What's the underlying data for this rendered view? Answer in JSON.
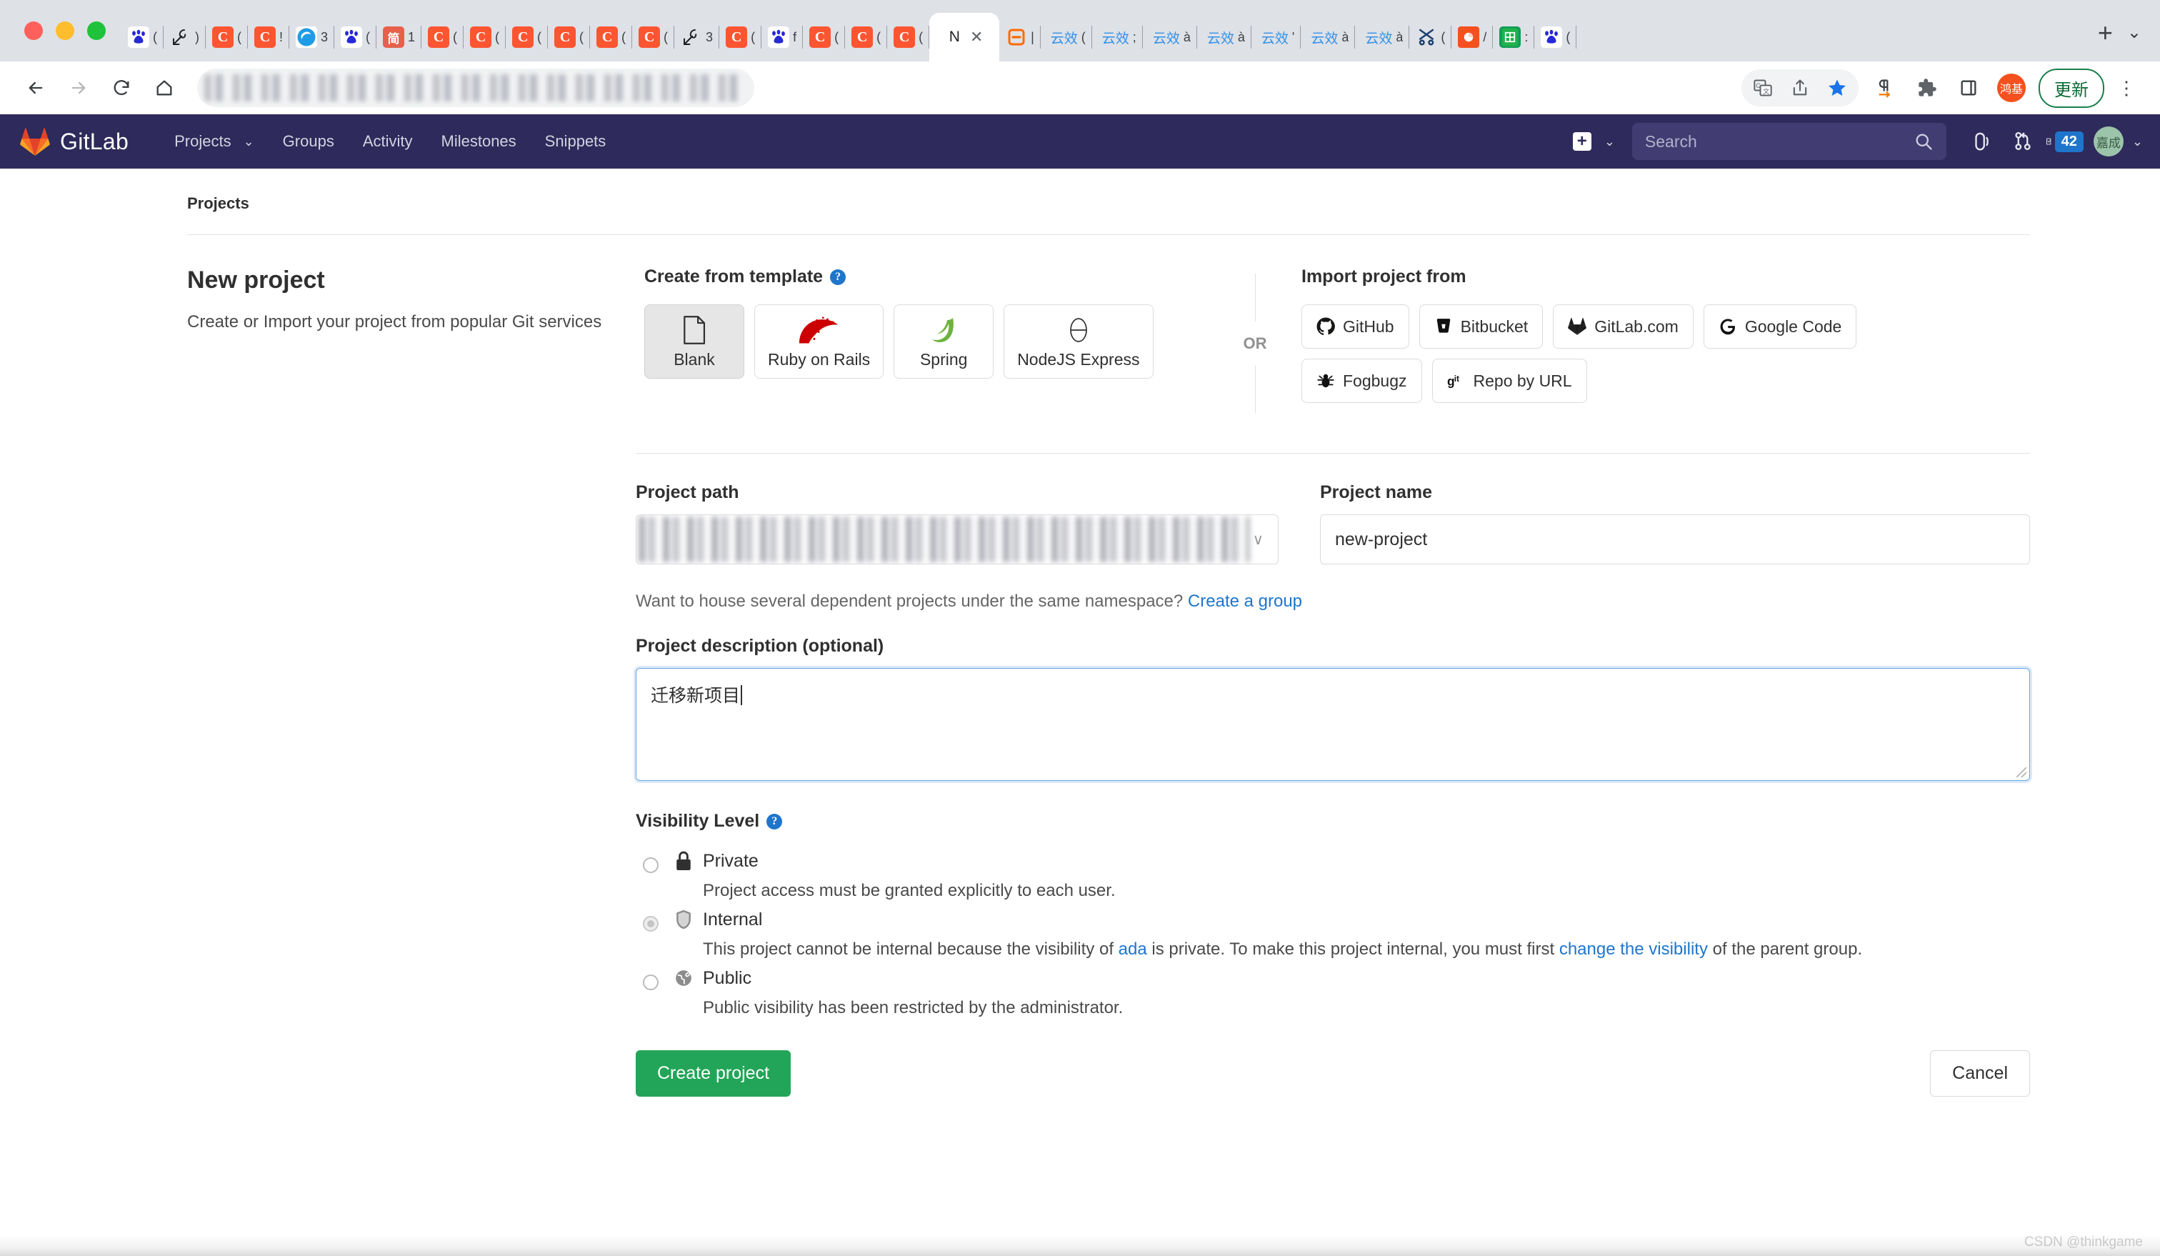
{
  "browser": {
    "window_controls": [
      "close",
      "minimize",
      "maximize"
    ],
    "tabs": [
      {
        "favicon": "baidu-icon",
        "title": "("
      },
      {
        "favicon": "onshape-icon",
        "title": ")"
      },
      {
        "favicon": "csdn-icon",
        "title": "("
      },
      {
        "favicon": "csdn-icon",
        "title": "!"
      },
      {
        "favicon": "edge-icon",
        "title": "3"
      },
      {
        "favicon": "baidu-icon",
        "title": "("
      },
      {
        "favicon": "jianshu-icon",
        "title": "1"
      },
      {
        "favicon": "csdn-icon",
        "title": "("
      },
      {
        "favicon": "csdn-icon",
        "title": "("
      },
      {
        "favicon": "csdn-icon",
        "title": "("
      },
      {
        "favicon": "csdn-icon",
        "title": "("
      },
      {
        "favicon": "csdn-icon",
        "title": "("
      },
      {
        "favicon": "csdn-icon",
        "title": "("
      },
      {
        "favicon": "onshape-icon",
        "title": "3"
      },
      {
        "favicon": "csdn-icon",
        "title": "("
      },
      {
        "favicon": "baidu-icon",
        "title": "f"
      },
      {
        "favicon": "csdn-icon",
        "title": "("
      },
      {
        "favicon": "csdn-icon",
        "title": "("
      },
      {
        "favicon": "csdn-icon",
        "title": "("
      }
    ],
    "active_tab": {
      "title": "N",
      "close_label": "✕"
    },
    "tabs_after": [
      {
        "favicon": "teambition-icon",
        "title": "|"
      },
      {
        "favicon": "",
        "title": "云效",
        "sub": "("
      },
      {
        "favicon": "",
        "title": "云效",
        "sub": ";"
      },
      {
        "favicon": "",
        "title": "云效",
        "sub": "à"
      },
      {
        "favicon": "",
        "title": "云效",
        "sub": "à"
      },
      {
        "favicon": "",
        "title": "云效",
        "sub": "'"
      },
      {
        "favicon": "",
        "title": "云效",
        "sub": "à"
      },
      {
        "favicon": "",
        "title": "云效",
        "sub": "à"
      },
      {
        "favicon": "xmind-icon",
        "title": "("
      },
      {
        "favicon": "wps-ppt-icon",
        "title": "/"
      },
      {
        "favicon": "wps-sheet-icon",
        "title": ":"
      },
      {
        "favicon": "baidu-icon",
        "title": "("
      }
    ],
    "new_tab_label": "+",
    "tabstrip_expander": "⌄",
    "nav": {
      "back": "back-arrow",
      "forward": "forward-arrow",
      "reload": "reload",
      "home": "home"
    },
    "omnibox_value": "",
    "toolbar_right": {
      "translate": "translate-icon",
      "share": "share-icon",
      "bookmark": "bookmark-star-icon",
      "pilcrow": "pilcrow-icon",
      "extensions": "puzzle-icon",
      "sidebar": "sidebar-icon",
      "profile_initials": "鸿基",
      "update_label": "更新",
      "menu": "kebab-menu-icon"
    }
  },
  "gitlab_nav": {
    "brand": "GitLab",
    "items": [
      {
        "label": "Projects",
        "has_caret": true
      },
      {
        "label": "Groups",
        "has_caret": false
      },
      {
        "label": "Activity",
        "has_caret": false
      },
      {
        "label": "Milestones",
        "has_caret": false
      },
      {
        "label": "Snippets",
        "has_caret": false
      }
    ],
    "search_placeholder": "Search",
    "search_value": "",
    "todos_count": "42",
    "avatar_initials": "嘉成",
    "accent_bg": "#2e2a5b",
    "search_bg": "#413d72",
    "badge_color": "#1f75cb"
  },
  "page": {
    "breadcrumb": "Projects",
    "title": "New project",
    "subtitle": "Create or Import your project from popular Git services",
    "watermark": "CSDN @thinkgame"
  },
  "templates": {
    "section_title": "Create from template",
    "help_glyph": "?",
    "cards": [
      {
        "label": "Blank",
        "icon": "blank-file-icon",
        "selected": true
      },
      {
        "label": "Ruby on Rails",
        "icon": "rails-icon",
        "selected": false
      },
      {
        "label": "Spring",
        "icon": "spring-leaf-icon",
        "selected": false
      },
      {
        "label": "NodeJS Express",
        "icon": "express-icon",
        "selected": false
      }
    ]
  },
  "divider": {
    "or_label": "OR"
  },
  "import": {
    "section_title": "Import project from",
    "row1": [
      {
        "label": "GitHub",
        "icon": "github-icon"
      },
      {
        "label": "Bitbucket",
        "icon": "bitbucket-icon"
      },
      {
        "label": "GitLab.com",
        "icon": "gitlab-icon"
      },
      {
        "label": "Google Code",
        "icon": "google-icon"
      }
    ],
    "row2": [
      {
        "label": "Fogbugz",
        "icon": "bug-icon"
      },
      {
        "label": "Repo by URL",
        "icon": "git-icon"
      }
    ]
  },
  "form": {
    "path_label": "Project path",
    "path_value": "",
    "path_caret": "∨",
    "name_label": "Project name",
    "name_value": "new-project",
    "namespace_hint_text": "Want to house several dependent projects under the same namespace? ",
    "namespace_hint_link": "Create a group",
    "description_label": "Project description (optional)",
    "description_value": "迁移新项目"
  },
  "visibility": {
    "title": "Visibility Level",
    "help_glyph": "?",
    "options": [
      {
        "name": "Private",
        "icon": "lock-icon",
        "state": "enabled",
        "desc_prefix": "Project access must be granted explicitly to each user.",
        "desc_link1": "",
        "desc_mid": "",
        "desc_link2": "",
        "desc_suffix": ""
      },
      {
        "name": "Internal",
        "icon": "shield-icon",
        "state": "disabled",
        "desc_prefix": "This project cannot be internal because the visibility of ",
        "desc_link1": "ada",
        "desc_mid": " is private. To make this project internal, you must first ",
        "desc_link2": "change the visibility",
        "desc_suffix": " of the parent group."
      },
      {
        "name": "Public",
        "icon": "globe-icon",
        "state": "enabled",
        "desc_prefix": "Public visibility has been restricted by the administrator.",
        "desc_link1": "",
        "desc_mid": "",
        "desc_link2": "",
        "desc_suffix": ""
      }
    ]
  },
  "actions": {
    "create_label": "Create project",
    "cancel_label": "Cancel",
    "create_color": "#22a558"
  }
}
